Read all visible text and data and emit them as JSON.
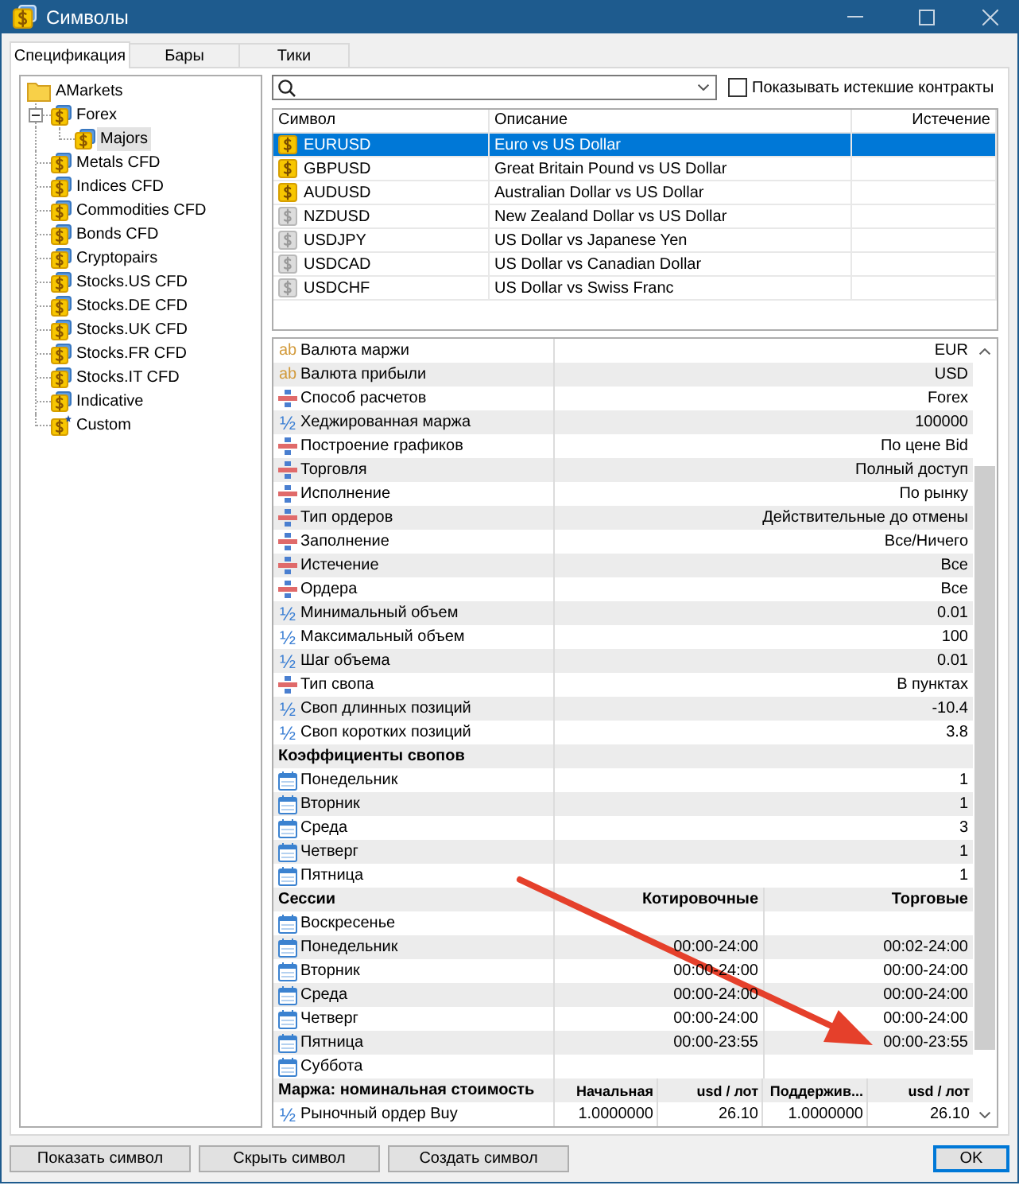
{
  "window": {
    "title": "Символы"
  },
  "tabs": [
    {
      "label": "Спецификация",
      "selected": true
    },
    {
      "label": "Бары",
      "selected": false
    },
    {
      "label": "Тики",
      "selected": false
    }
  ],
  "tree": {
    "items": [
      {
        "label": "AMarkets",
        "kind": "folder",
        "selected": false,
        "children": [
          {
            "label": "Forex",
            "kind": "group",
            "selected": false,
            "expanded": true,
            "children": [
              {
                "label": "Majors",
                "kind": "group",
                "selected": true
              }
            ]
          },
          {
            "label": "Metals CFD",
            "kind": "group",
            "selected": false
          },
          {
            "label": "Indices CFD",
            "kind": "group",
            "selected": false
          },
          {
            "label": "Commodities CFD",
            "kind": "group",
            "selected": false
          },
          {
            "label": "Bonds CFD",
            "kind": "group",
            "selected": false
          },
          {
            "label": "Cryptopairs",
            "kind": "group",
            "selected": false
          },
          {
            "label": "Stocks.US CFD",
            "kind": "group",
            "selected": false
          },
          {
            "label": "Stocks.DE CFD",
            "kind": "group",
            "selected": false
          },
          {
            "label": "Stocks.UK CFD",
            "kind": "group",
            "selected": false
          },
          {
            "label": "Stocks.FR CFD",
            "kind": "group",
            "selected": false
          },
          {
            "label": "Stocks.IT CFD",
            "kind": "group",
            "selected": false
          },
          {
            "label": "Indicative",
            "kind": "group",
            "selected": false
          },
          {
            "label": "Custom",
            "kind": "custom",
            "selected": false
          }
        ]
      }
    ]
  },
  "show_expired": {
    "label": "Показывать истекшие контракты",
    "checked": false
  },
  "symbols": {
    "columns": [
      "Символ",
      "Описание",
      "Истечение"
    ],
    "rows": [
      {
        "symbol": "EURUSD",
        "description": "Euro vs US Dollar",
        "active": true,
        "selected": true
      },
      {
        "symbol": "GBPUSD",
        "description": "Great Britain Pound vs US Dollar",
        "active": true,
        "selected": false
      },
      {
        "symbol": "AUDUSD",
        "description": "Australian Dollar vs US Dollar",
        "active": true,
        "selected": false
      },
      {
        "symbol": "NZDUSD",
        "description": "New Zealand Dollar vs US Dollar",
        "active": false,
        "selected": false
      },
      {
        "symbol": "USDJPY",
        "description": "US Dollar vs Japanese Yen",
        "active": false,
        "selected": false
      },
      {
        "symbol": "USDCAD",
        "description": "US Dollar vs Canadian Dollar",
        "active": false,
        "selected": false
      },
      {
        "symbol": "USDCHF",
        "description": "US Dollar vs Swiss Franc",
        "active": false,
        "selected": false
      }
    ]
  },
  "properties": [
    {
      "kind": "text",
      "glyph": "ab",
      "name": "Валюта маржи",
      "value": "EUR"
    },
    {
      "kind": "text",
      "glyph": "ab",
      "name": "Валюта прибыли",
      "value": "USD"
    },
    {
      "kind": "enum",
      "name": "Способ расчетов",
      "value": "Forex"
    },
    {
      "kind": "number",
      "glyph": "½",
      "name": "Хеджированная маржа",
      "value": "100000"
    },
    {
      "kind": "enum",
      "name": "Построение графиков",
      "value": "По цене Bid"
    },
    {
      "kind": "enum",
      "name": "Торговля",
      "value": "Полный доступ"
    },
    {
      "kind": "enum",
      "name": "Исполнение",
      "value": "По рынку"
    },
    {
      "kind": "enum",
      "name": "Тип ордеров",
      "value": "Действительные до отмены"
    },
    {
      "kind": "enum",
      "name": "Заполнение",
      "value": "Все/Ничего"
    },
    {
      "kind": "enum",
      "name": "Истечение",
      "value": "Все"
    },
    {
      "kind": "enum",
      "name": "Ордера",
      "value": "Все"
    },
    {
      "kind": "number",
      "glyph": "½",
      "name": "Минимальный объем",
      "value": "0.01"
    },
    {
      "kind": "number",
      "glyph": "½",
      "name": "Максимальный объем",
      "value": "100"
    },
    {
      "kind": "number",
      "glyph": "½",
      "name": "Шаг объема",
      "value": "0.01"
    },
    {
      "kind": "enum",
      "name": "Тип свопа",
      "value": "В пунктах"
    },
    {
      "kind": "number",
      "glyph": "½",
      "name": "Своп длинных позиций",
      "value": "-10.4"
    },
    {
      "kind": "number",
      "glyph": "½",
      "name": "Своп коротких позиций",
      "value": "3.8"
    }
  ],
  "swap_rates": {
    "title": "Коэффициенты свопов",
    "rows": [
      {
        "day": "Понедельник",
        "value": "1"
      },
      {
        "day": "Вторник",
        "value": "1"
      },
      {
        "day": "Среда",
        "value": "3"
      },
      {
        "day": "Четверг",
        "value": "1"
      },
      {
        "day": "Пятница",
        "value": "1"
      }
    ]
  },
  "sessions": {
    "title": "Сессии",
    "columns": [
      "Котировочные",
      "Торговые"
    ],
    "rows": [
      {
        "day": "Воскресенье"
      },
      {
        "day": "Понедельник",
        "quote": "00:00-24:00",
        "trade": "00:02-24:00"
      },
      {
        "day": "Вторник",
        "quote": "00:00-24:00",
        "trade": "00:00-24:00"
      },
      {
        "day": "Среда",
        "quote": "00:00-24:00",
        "trade": "00:00-24:00"
      },
      {
        "day": "Четверг",
        "quote": "00:00-24:00",
        "trade": "00:00-24:00"
      },
      {
        "day": "Пятница",
        "quote": "00:00-23:55",
        "trade": "00:00-23:55"
      },
      {
        "day": "Суббота"
      }
    ]
  },
  "margin": {
    "title": "Маржа: номинальная стоимость",
    "columns": [
      "Начальная",
      "usd / лот",
      "Поддержив...",
      "usd / лот"
    ],
    "rows": [
      {
        "kind": "number",
        "glyph": "½",
        "name": "Рыночный ордер Buy",
        "values": [
          "1.0000000",
          "26.10",
          "1.0000000",
          "26.10"
        ]
      }
    ]
  },
  "buttons": [
    {
      "label": "Показать символ",
      "kind": "normal"
    },
    {
      "label": "Скрыть символ",
      "kind": "normal"
    },
    {
      "label": "Создать символ",
      "kind": "normal"
    },
    {
      "label": "OK",
      "kind": "default"
    }
  ],
  "annotations": [
    {
      "kind": "arrow"
    }
  ]
}
